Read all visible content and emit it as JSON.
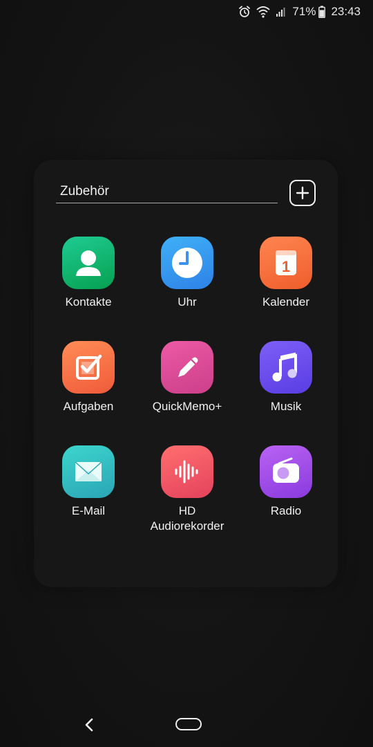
{
  "status_bar": {
    "battery_percent": "71%",
    "time": "23:43",
    "icons": [
      "alarm-icon",
      "wifi-icon",
      "signal-icon",
      "battery-icon"
    ]
  },
  "folder": {
    "name": "Zubehör",
    "add_icon": "plus-icon"
  },
  "apps": [
    {
      "label": "Kontakte",
      "icon": "contact-icon",
      "colors": [
        "#1cc38a",
        "#0aa25a"
      ]
    },
    {
      "label": "Uhr",
      "icon": "clock-icon",
      "colors": [
        "#3aa7f5",
        "#2f86e8"
      ]
    },
    {
      "label": "Kalender",
      "icon": "calendar-icon",
      "colors": [
        "#ff7f45",
        "#f0612e"
      ],
      "badge": "1"
    },
    {
      "label": "Aufgaben",
      "icon": "task-checkbox-icon",
      "colors": [
        "#ff8a54",
        "#f25d3b"
      ]
    },
    {
      "label": "QuickMemo+",
      "icon": "pencil-icon",
      "colors": [
        "#e8559e",
        "#d2408d"
      ]
    },
    {
      "label": "Musik",
      "icon": "music-note-icon",
      "colors": [
        "#7a5cf5",
        "#5c3fe6"
      ]
    },
    {
      "label": "E-Mail",
      "icon": "envelope-icon",
      "colors": [
        "#36d0c8",
        "#2aaab7"
      ]
    },
    {
      "label": "HD\nAudiorekorder",
      "icon": "soundwave-icon",
      "colors": [
        "#ff6a6a",
        "#e7445d"
      ]
    },
    {
      "label": "Radio",
      "icon": "radio-icon",
      "colors": [
        "#b45cf2",
        "#8c3ee0"
      ]
    }
  ],
  "nav_bar": {
    "back_icon": "back-chevron-icon",
    "home_icon": "home-pill-icon"
  }
}
